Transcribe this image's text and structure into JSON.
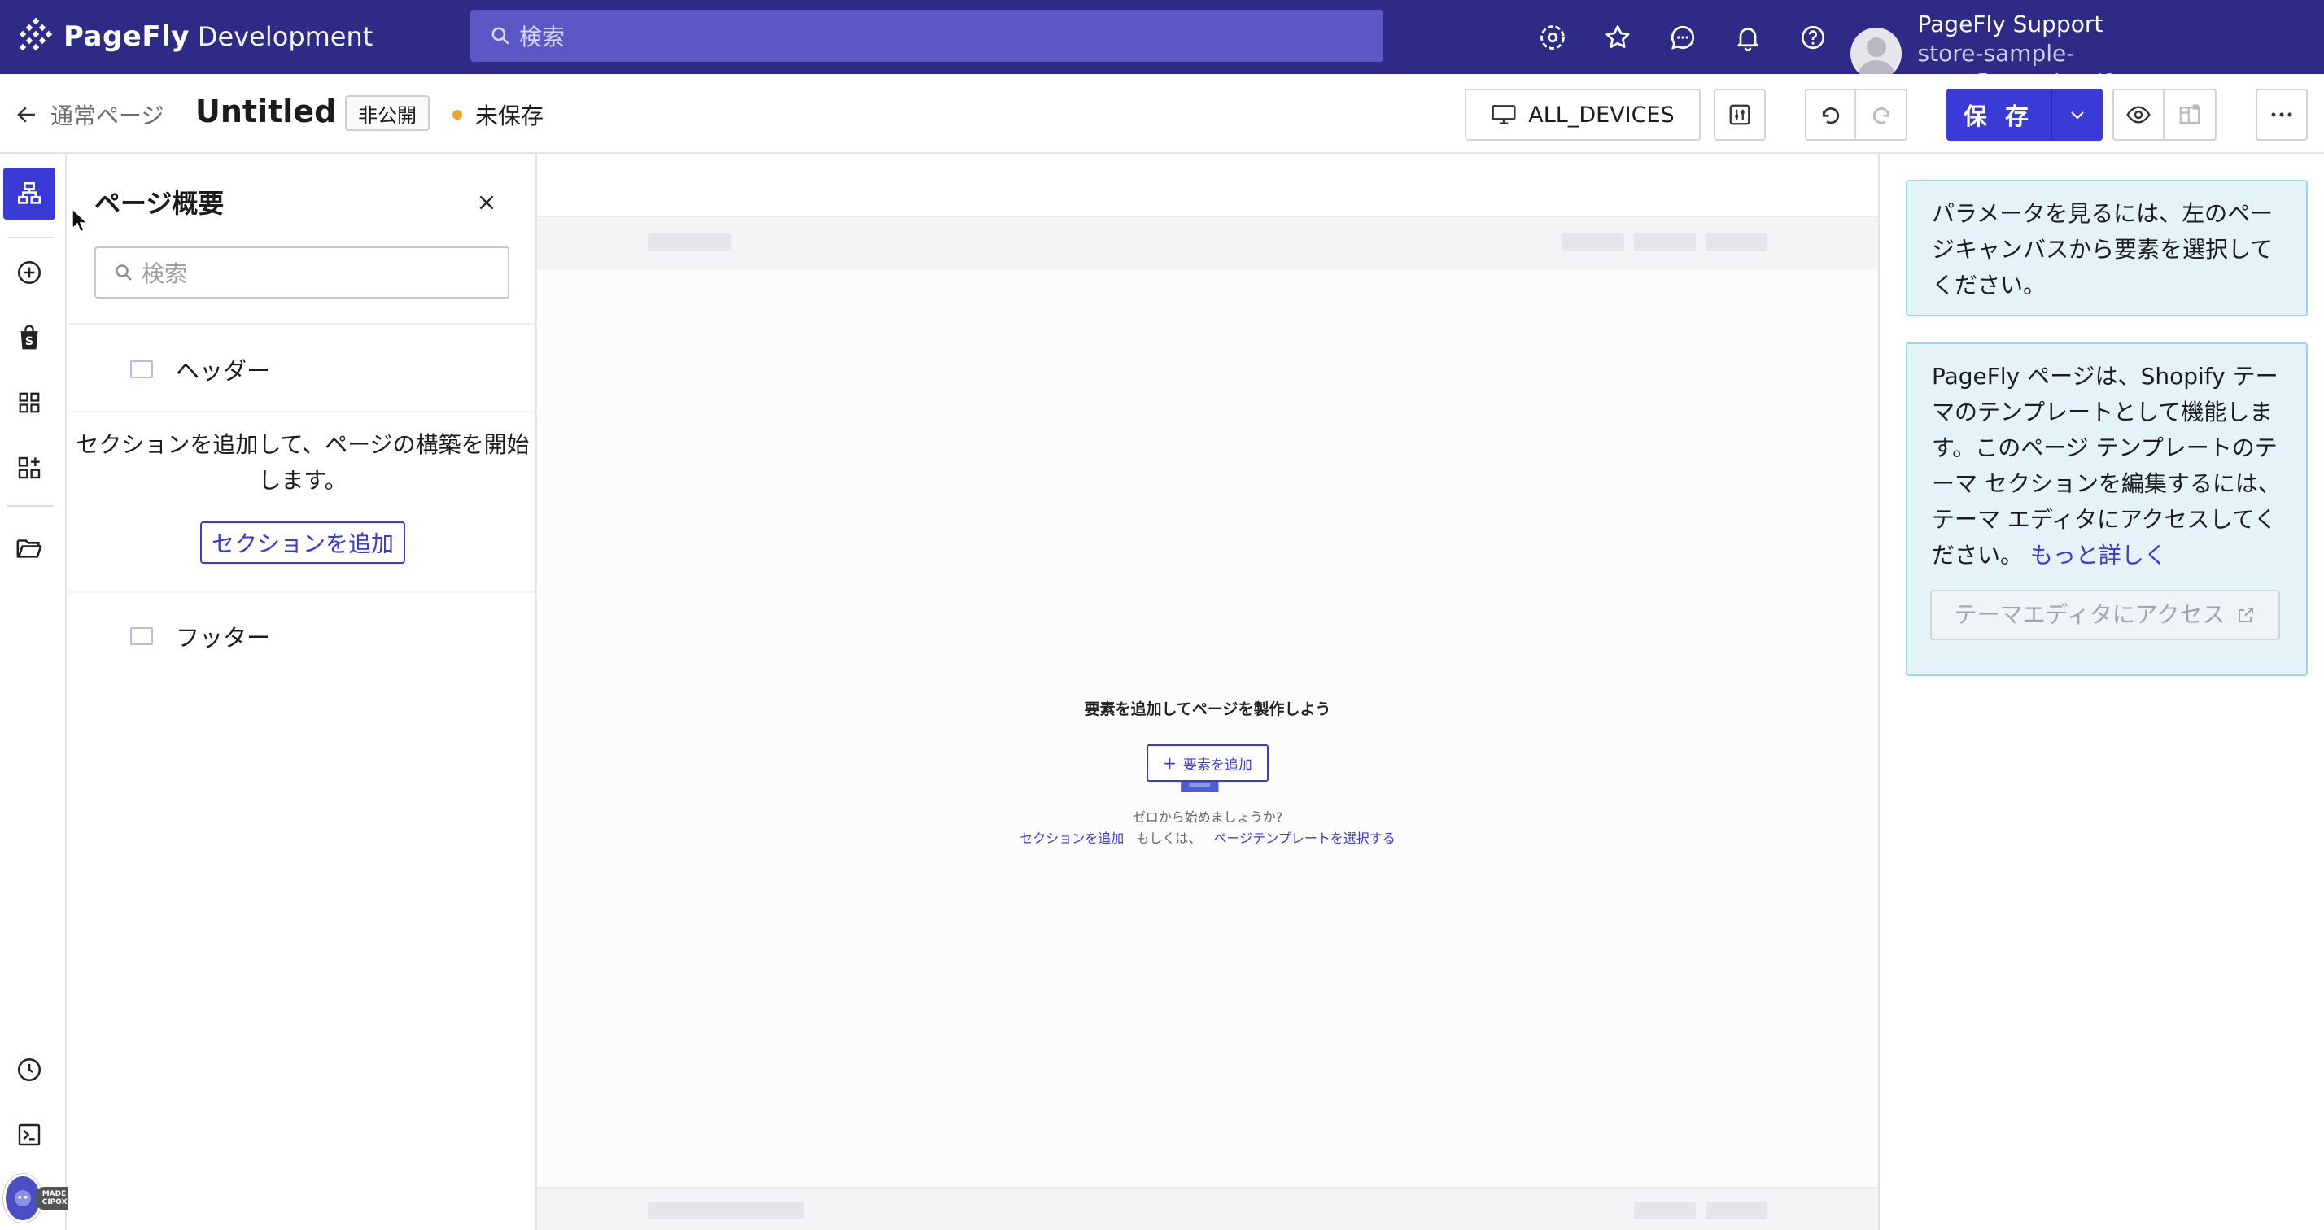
{
  "topbar": {
    "brand": "PageFly",
    "environment": "Development",
    "search_placeholder": "検索",
    "icons": [
      "settings-gear-icon",
      "star-icon",
      "chat-icon",
      "bell-icon",
      "help-icon"
    ],
    "account_name": "PageFly Support",
    "account_store": "store-sample-pagefly.myshopify.com",
    "bg_color": "#2d2b85"
  },
  "subbar": {
    "back_label": "通常ページ",
    "page_title": "Untitled",
    "visibility_badge": "非公開",
    "save_status": "未保存",
    "devices_label": "ALL_DEVICES",
    "save_label": "保 存"
  },
  "outline": {
    "title": "ページ概要",
    "search_placeholder": "検索",
    "header_label": "ヘッダー",
    "empty_text_line1": "セクションを追加して、ページの構築を開始",
    "empty_text_line2": "します。",
    "add_section_label": "セクションを追加",
    "footer_label": "フッター"
  },
  "canvas": {
    "empty_title": "要素を追加してページを製作しよう",
    "add_element_label": "要素を追加",
    "zero_text": "ゼロから始めましょうか?",
    "link_add_section": "セクションを追加",
    "or_text": "もしくは、",
    "link_select_template": "ページテンプレートを選択する"
  },
  "right_panel": {
    "info1": "パラメータを見るには、左のページキャンバスから要素を選択してください。",
    "info2_text": "PageFly ページは、Shopify テーマのテンプレートとして機能します。このページ テンプレートのテーマ セクションを編集するには、テーマ エディタにアクセスしてください。",
    "learn_more": "もっと詳しく",
    "theme_editor_btn": "テーマエディタにアクセス"
  },
  "badge": {
    "cipox": "MADE WITH CIPOX"
  },
  "colors": {
    "accent": "#3a3bd6",
    "unsaved_dot": "#f0a32a",
    "info_bg": "#e4f3fa"
  }
}
